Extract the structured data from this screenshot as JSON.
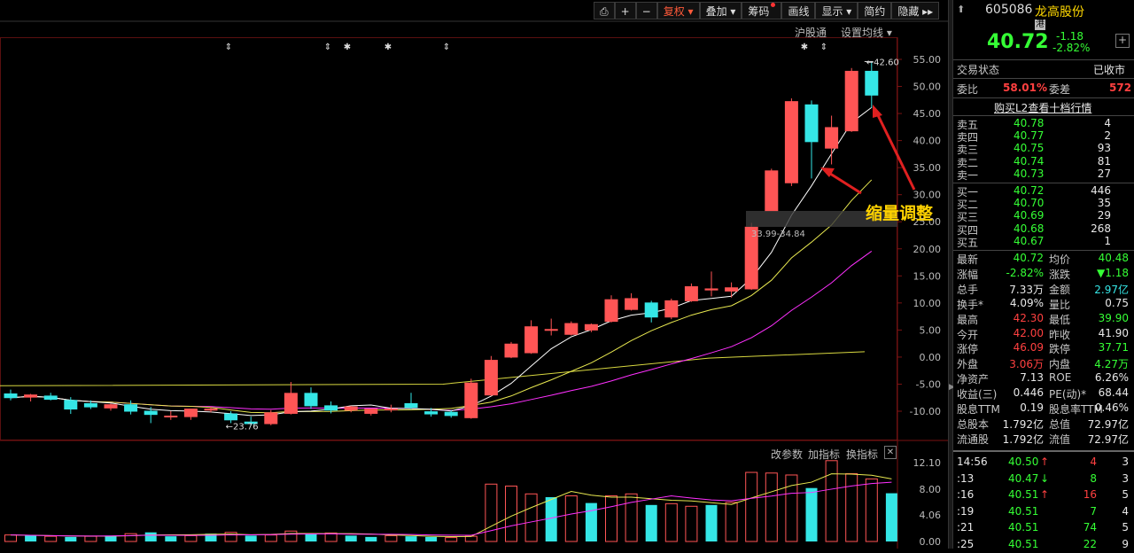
{
  "toolbar": {
    "items": [
      {
        "label": "⎙",
        "name": "print-icon"
      },
      {
        "label": "+",
        "name": "zoom-in-button"
      },
      {
        "label": "−",
        "name": "zoom-out-button"
      },
      {
        "label": "复权 ▾",
        "name": "adjust-button",
        "active": true
      },
      {
        "label": "叠加 ▾",
        "name": "overlay-button"
      },
      {
        "label": "筹码",
        "name": "chips-button",
        "dot": true
      },
      {
        "label": "画线",
        "name": "draw-button"
      },
      {
        "label": "显示 ▾",
        "name": "display-button"
      },
      {
        "label": "简约",
        "name": "simple-button"
      },
      {
        "label": "隐藏 ▸▸",
        "name": "hide-button"
      }
    ]
  },
  "main_header": {
    "hgt": "沪股通",
    "ma_settings": "设置均线 ▾"
  },
  "sub_header": {
    "params": "改参数",
    "add_indicator": "加指标",
    "switch_indicator": "换指标",
    "close": "✕"
  },
  "annotation": {
    "text": "缩量调整",
    "color": "#ffd200",
    "arrow_color": "#e02020"
  },
  "labels": {
    "high": "42.60",
    "low": "23.76",
    "gap": "33.99-34.84"
  },
  "chart_data": {
    "type": "candlestick",
    "price_axis": {
      "ticks": [
        "55.00",
        "50.00",
        "45.00",
        "40.00",
        "35.00",
        "30.00",
        "25.00",
        "20.00",
        "15.00",
        "10.00",
        "5.00",
        "0.00",
        "-5.00",
        "-10.00"
      ]
    },
    "volume_axis": {
      "ticks": [
        "12.10",
        "8.00",
        "4.06",
        "0.00"
      ]
    },
    "colors": {
      "up": "#ff5555",
      "down": "#35e6e6",
      "ma5": "#ffffff",
      "ma10": "#e8e850",
      "ma20": "#ff30ff",
      "ma60": "#d8d840",
      "vol_ma": "#e8e850",
      "vol_ma2": "#ff30ff"
    },
    "candles": [
      {
        "o": -6.8,
        "h": -6.0,
        "l": -8.0,
        "c": -7.5
      },
      {
        "o": -7.4,
        "h": -6.8,
        "l": -8.2,
        "c": -7.0
      },
      {
        "o": -7.2,
        "h": -6.6,
        "l": -8.0,
        "c": -7.8
      },
      {
        "o": -8.0,
        "h": -7.4,
        "l": -10.5,
        "c": -9.6
      },
      {
        "o": -8.6,
        "h": -8.0,
        "l": -9.6,
        "c": -9.2
      },
      {
        "o": -9.4,
        "h": -8.6,
        "l": -9.9,
        "c": -8.8
      },
      {
        "o": -8.8,
        "h": -8.0,
        "l": -10.6,
        "c": -10.0
      },
      {
        "o": -10.0,
        "h": -9.2,
        "l": -12.2,
        "c": -10.6
      },
      {
        "o": -10.9,
        "h": -10.0,
        "l": -11.6,
        "c": -10.9
      },
      {
        "o": -11.0,
        "h": -9.6,
        "l": -11.6,
        "c": -9.6
      },
      {
        "o": -9.8,
        "h": -9.2,
        "l": -10.2,
        "c": -9.6
      },
      {
        "o": -10.5,
        "h": -10.0,
        "l": -12.2,
        "c": -11.6
      },
      {
        "o": -12.0,
        "h": -11.0,
        "l": -12.7,
        "c": -12.3
      },
      {
        "o": -12.3,
        "h": -9.8,
        "l": -12.6,
        "c": -10.3
      },
      {
        "o": -10.4,
        "h": -4.6,
        "l": -10.6,
        "c": -6.7
      },
      {
        "o": -6.7,
        "h": -5.6,
        "l": -9.6,
        "c": -9.0
      },
      {
        "o": -9.0,
        "h": -8.2,
        "l": -10.4,
        "c": -9.8
      },
      {
        "o": -9.8,
        "h": -9.0,
        "l": -10.2,
        "c": -9.2
      },
      {
        "o": -10.4,
        "h": -9.6,
        "l": -10.8,
        "c": -9.6
      },
      {
        "o": -9.6,
        "h": -8.8,
        "l": -10.2,
        "c": -9.6
      },
      {
        "o": -8.6,
        "h": -6.6,
        "l": -9.6,
        "c": -9.3
      },
      {
        "o": -10.1,
        "h": -9.4,
        "l": -11.0,
        "c": -10.5
      },
      {
        "o": -10.2,
        "h": -9.8,
        "l": -11.2,
        "c": -10.8
      },
      {
        "o": -11.2,
        "h": -4.0,
        "l": -11.4,
        "c": -4.8
      },
      {
        "o": -7.0,
        "h": 0.2,
        "l": -7.2,
        "c": -0.6
      },
      {
        "o": 0.0,
        "h": 2.8,
        "l": -0.2,
        "c": 2.4
      },
      {
        "o": 0.8,
        "h": 6.8,
        "l": 0.6,
        "c": 5.6
      },
      {
        "o": 5.0,
        "h": 7.1,
        "l": 4.0,
        "c": 5.1
      },
      {
        "o": 4.2,
        "h": 6.6,
        "l": 4.0,
        "c": 6.2
      },
      {
        "o": 5.0,
        "h": 6.2,
        "l": 4.6,
        "c": 6.0
      },
      {
        "o": 6.6,
        "h": 11.4,
        "l": 6.4,
        "c": 10.6
      },
      {
        "o": 8.8,
        "h": 11.8,
        "l": 8.6,
        "c": 10.8
      },
      {
        "o": 10.0,
        "h": 10.4,
        "l": 6.4,
        "c": 7.4
      },
      {
        "o": 7.4,
        "h": 10.8,
        "l": 7.0,
        "c": 10.4
      },
      {
        "o": 10.4,
        "h": 13.6,
        "l": 10.2,
        "c": 13.0
      },
      {
        "o": 12.4,
        "h": 15.8,
        "l": 11.2,
        "c": 12.6
      },
      {
        "o": 12.2,
        "h": 13.8,
        "l": 11.0,
        "c": 12.8
      },
      {
        "o": 12.6,
        "h": 24.8,
        "l": 12.4,
        "c": 24.0
      },
      {
        "o": 27.0,
        "h": 34.8,
        "l": 27.0,
        "c": 34.4
      },
      {
        "o": 32.2,
        "h": 47.8,
        "l": 31.6,
        "c": 47.2
      },
      {
        "o": 46.6,
        "h": 47.4,
        "l": 33.0,
        "c": 39.8
      },
      {
        "o": 38.6,
        "h": 44.6,
        "l": 35.6,
        "c": 42.4
      },
      {
        "o": 41.8,
        "h": 53.4,
        "l": 41.6,
        "c": 52.8
      },
      {
        "o": 52.8,
        "h": 54.6,
        "l": 46.0,
        "c": 48.4
      }
    ],
    "volumes": [
      1.0,
      0.9,
      0.8,
      0.7,
      0.8,
      0.9,
      1.2,
      1.4,
      0.8,
      0.9,
      1.2,
      1.4,
      0.9,
      1.0,
      1.6,
      1.2,
      1.3,
      0.9,
      0.7,
      0.9,
      0.8,
      0.7,
      0.6,
      0.8,
      8.8,
      8.5,
      7.3,
      6.8,
      7.0,
      5.9,
      7.0,
      7.3,
      5.6,
      5.8,
      5.4,
      5.6,
      6.0,
      10.6,
      10.5,
      10.2,
      8.2,
      12.4,
      10.4,
      9.6,
      7.4
    ],
    "vol_up": [
      true,
      false,
      true,
      false,
      true,
      false,
      true,
      false,
      false,
      true,
      false,
      true,
      false,
      true,
      true,
      false,
      true,
      false,
      false,
      true,
      false,
      false,
      true,
      true,
      true,
      true,
      true,
      false,
      true,
      false,
      true,
      true,
      false,
      true,
      true,
      false,
      true,
      true,
      true,
      true,
      false,
      true,
      true,
      true,
      false
    ]
  },
  "side": {
    "code": "605086",
    "name": "龙高股份",
    "badge": "港",
    "price": "40.72",
    "change": "-1.18",
    "pct": "-2.82%",
    "status_label": "交易状态",
    "status_value": "已收市",
    "weibi_label": "委比",
    "weibi": "58.01%",
    "weicha_label": "委差",
    "weicha": "572",
    "l2_link": "购买L2查看十档行情",
    "asks": [
      [
        "卖五",
        "40.78",
        "4"
      ],
      [
        "卖四",
        "40.77",
        "2"
      ],
      [
        "卖三",
        "40.75",
        "93"
      ],
      [
        "卖二",
        "40.74",
        "81"
      ],
      [
        "卖一",
        "40.73",
        "27"
      ]
    ],
    "bids": [
      [
        "买一",
        "40.72",
        "446"
      ],
      [
        "买二",
        "40.70",
        "35"
      ],
      [
        "买三",
        "40.69",
        "29"
      ],
      [
        "买四",
        "40.68",
        "268"
      ],
      [
        "买五",
        "40.67",
        "1"
      ]
    ],
    "stats": [
      [
        "最新",
        "40.72",
        "g",
        "均价",
        "40.48",
        "g"
      ],
      [
        "涨幅",
        "-2.82%",
        "g",
        "涨跌",
        "▼1.18",
        "g"
      ],
      [
        "总手",
        "7.33万",
        "w",
        "金额",
        "2.97亿",
        "c"
      ],
      [
        "换手*",
        "4.09%",
        "w",
        "量比",
        "0.75",
        "w"
      ],
      [
        "最高",
        "42.30",
        "r",
        "最低",
        "39.90",
        "g"
      ],
      [
        "今开",
        "42.00",
        "r",
        "昨收",
        "41.90",
        "w"
      ],
      [
        "涨停",
        "46.09",
        "r",
        "跌停",
        "37.71",
        "g"
      ],
      [
        "外盘",
        "3.06万",
        "r",
        "内盘",
        "4.27万",
        "g"
      ],
      [
        "净资产",
        "7.13",
        "w",
        "ROE",
        "6.26%",
        "w"
      ],
      [
        "收益(三)",
        "0.446",
        "w",
        "PE(动)*",
        "68.44",
        "w"
      ],
      [
        "股息TTM",
        "0.19",
        "w",
        "股息率TTM",
        "0.46%",
        "w"
      ],
      [
        "总股本",
        "1.792亿",
        "w",
        "总值",
        "72.97亿",
        "w"
      ],
      [
        "流通股",
        "1.792亿",
        "w",
        "流值",
        "72.97亿",
        "w"
      ]
    ],
    "ticks": [
      [
        "14:56",
        "40.50",
        "↑",
        "4",
        "3",
        "r"
      ],
      [
        ":13",
        "40.47",
        "↓",
        "8",
        "3",
        "g"
      ],
      [
        ":16",
        "40.51",
        "↑",
        "16",
        "5",
        "r"
      ],
      [
        ":19",
        "40.51",
        "",
        "7",
        "4",
        "g"
      ],
      [
        ":21",
        "40.51",
        "",
        "74",
        "5",
        "g"
      ],
      [
        ":25",
        "40.51",
        "",
        "22",
        "9",
        "g"
      ]
    ]
  }
}
